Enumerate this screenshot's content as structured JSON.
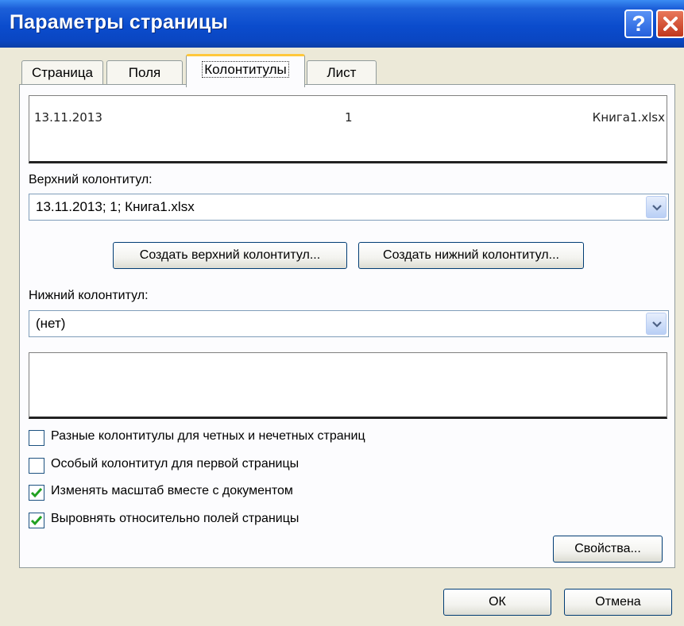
{
  "window": {
    "title": "Параметры страницы",
    "help_glyph": "?",
    "colors": {
      "titlebar": "#0b4ccd",
      "dialog_bg": "#ece9d8",
      "close_button": "#c1371c",
      "active_tab_accent": "#ffc83c",
      "checkmark": "#21a121"
    }
  },
  "tabs": [
    {
      "label": "Страница"
    },
    {
      "label": "Поля"
    },
    {
      "label": "Колонтитулы",
      "active": true
    },
    {
      "label": "Лист"
    }
  ],
  "header_preview": {
    "left": "13.11.2013",
    "center": "1",
    "right": "Книга1.xlsx"
  },
  "header": {
    "label": "Верхний колонтитул:",
    "value": "13.11.2013; 1; Книга1.xlsx",
    "create_button": "Создать верхний колонтитул..."
  },
  "footer": {
    "label": "Нижний колонтитул:",
    "value": "(нет)",
    "create_button": "Создать нижний колонтитул..."
  },
  "options": [
    {
      "label": "Разные колонтитулы для четных и нечетных страниц",
      "checked": false
    },
    {
      "label": "Особый колонтитул для первой страницы",
      "checked": false
    },
    {
      "label": "Изменять масштаб вместе с документом",
      "checked": true
    },
    {
      "label": "Выровнять относительно полей страницы",
      "checked": true
    }
  ],
  "buttons": {
    "properties": "Свойства...",
    "ok": "ОК",
    "cancel": "Отмена"
  },
  "icons": {
    "help": "help-icon",
    "close": "close-icon",
    "dropdown": "chevron-down-icon",
    "check": "checkmark-icon"
  }
}
